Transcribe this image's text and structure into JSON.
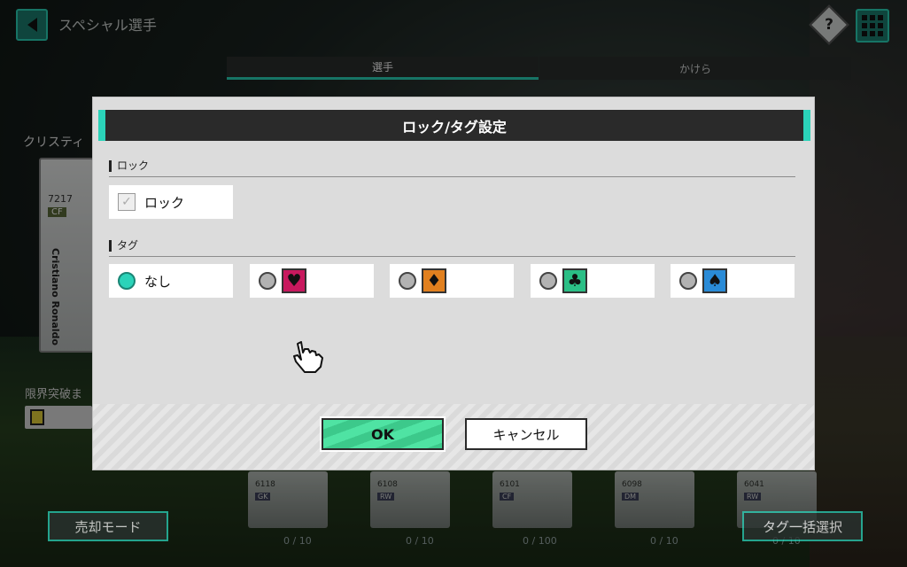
{
  "screen": {
    "title": "スペシャル選手"
  },
  "tabs": [
    {
      "label": "選手",
      "active": true
    },
    {
      "label": "かけら",
      "active": false
    }
  ],
  "help_label": "?",
  "player": {
    "name": "クリスティ",
    "rating": "7217",
    "position": "CF",
    "card_name": "Cristiano Ronaldo"
  },
  "limit_label": "限界突破ま",
  "modal": {
    "title": "ロック/タグ設定",
    "lock_section": {
      "label": "ロック",
      "checkbox_label": "ロック",
      "checked": true
    },
    "tag_section": {
      "label": "タグ",
      "options": [
        {
          "label": "なし",
          "selected": true,
          "icon": null
        },
        {
          "label": "",
          "selected": false,
          "icon": "heart-icon",
          "glyph": "♥",
          "color": "#c8195e"
        },
        {
          "label": "",
          "selected": false,
          "icon": "diamond-icon",
          "glyph": "♦",
          "color": "#e1801f"
        },
        {
          "label": "",
          "selected": false,
          "icon": "club-icon",
          "glyph": "♣",
          "color": "#2bbf86"
        },
        {
          "label": "",
          "selected": false,
          "icon": "spade-icon",
          "glyph": "♠",
          "color": "#2a8bd7"
        }
      ]
    },
    "ok_label": "OK",
    "cancel_label": "キャンセル"
  },
  "bottom_cards": [
    {
      "rating": "6118",
      "position": "GK",
      "count": "0 / 10"
    },
    {
      "rating": "6108",
      "position": "RW",
      "count": "0 / 10"
    },
    {
      "rating": "6101",
      "position": "CF",
      "count": "0 / 100"
    },
    {
      "rating": "6098",
      "position": "DM",
      "count": "0 / 10"
    },
    {
      "rating": "6041",
      "position": "RW",
      "count": "0 / 10"
    }
  ],
  "buttons": {
    "sell_mode": "売却モード",
    "tag_bulk_select": "タグ一括選択"
  },
  "colors": {
    "accent": "#2bd3b9",
    "ok_green": "#4fe3a3",
    "modal_bg": "#dcdcdc",
    "header_bg": "#2a2a2a"
  }
}
